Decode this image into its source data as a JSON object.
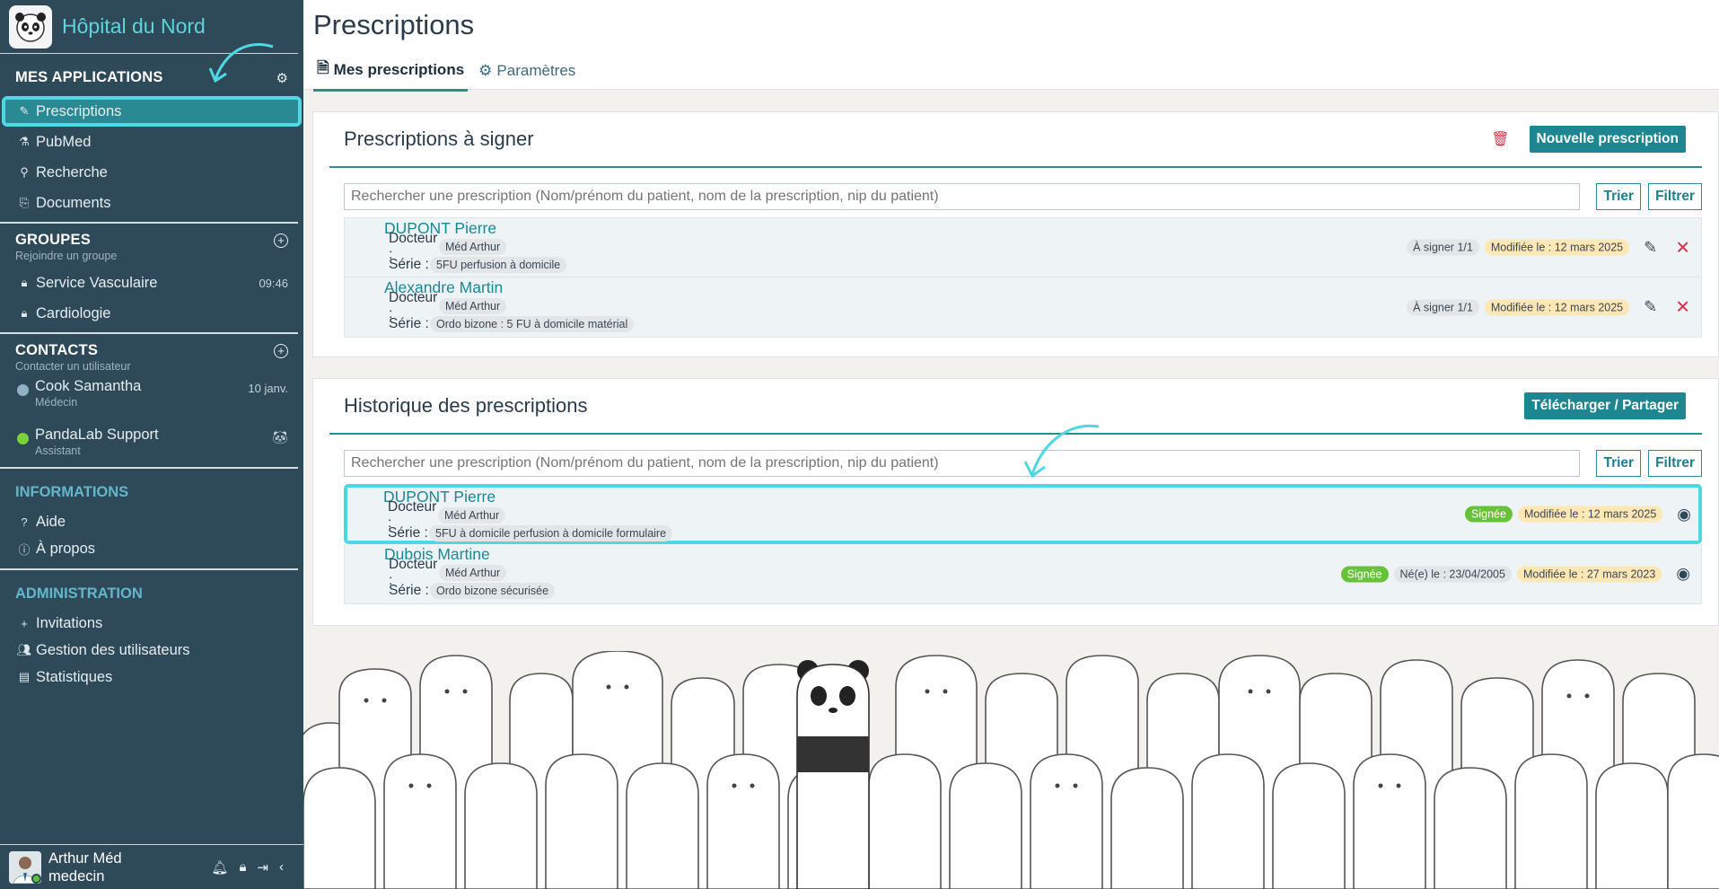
{
  "sidebar": {
    "brand": "Hôpital du Nord",
    "apps": {
      "title": "MES APPLICATIONS",
      "items": [
        {
          "label": "Prescriptions"
        },
        {
          "label": "PubMed"
        },
        {
          "label": "Recherche"
        },
        {
          "label": "Documents"
        }
      ]
    },
    "groups": {
      "title": "GROUPES",
      "subtitle": "Rejoindre un groupe",
      "items": [
        {
          "label": "Service Vasculaire",
          "time": "09:46"
        },
        {
          "label": "Cardiologie",
          "time": ""
        }
      ]
    },
    "contacts": {
      "title": "CONTACTS",
      "subtitle": "Contacter un utilisateur",
      "items": [
        {
          "name": "Cook Samantha",
          "role": "Médecin",
          "meta": "10 janv.",
          "status_color": "#8fb2c4"
        },
        {
          "name": "PandaLab Support",
          "role": "Assistant",
          "meta": "",
          "status_color": "#7bd13a"
        }
      ]
    },
    "informations": {
      "title": "INFORMATIONS",
      "items": [
        {
          "label": "Aide"
        },
        {
          "label": "À propos"
        }
      ]
    },
    "administration": {
      "title": "ADMINISTRATION",
      "items": [
        {
          "label": "Invitations"
        },
        {
          "label": "Gestion des utilisateurs"
        },
        {
          "label": "Statistiques"
        }
      ]
    },
    "user": {
      "name": "Arthur Méd",
      "role": "medecin"
    }
  },
  "header": {
    "title": "Prescriptions",
    "tabs": [
      {
        "label": "Mes prescriptions"
      },
      {
        "label": "Paramètres"
      }
    ]
  },
  "to_sign": {
    "title": "Prescriptions à signer",
    "new_button": "Nouvelle prescription",
    "search_placeholder": "Rechercher une prescription (Nom/prénom du patient, nom de la prescription, nip du patient)",
    "sort_label": "Trier",
    "filter_label": "Filtrer",
    "doctor_label": "Docteur :",
    "series_label": "Série :",
    "rows": [
      {
        "patient": "DUPONT Pierre",
        "doctor": "Méd Arthur",
        "series": "5FU perfusion à domicile",
        "status": "À signer 1/1",
        "modified": "Modifiée le : 12 mars 2025"
      },
      {
        "patient": "Alexandre Martin",
        "doctor": "Méd Arthur",
        "series": "Ordo bizone : 5 FU à domicile matérial",
        "status": "À signer 1/1",
        "modified": "Modifiée le : 12 mars 2025"
      }
    ]
  },
  "history": {
    "title": "Historique des prescriptions",
    "download_button": "Télécharger / Partager",
    "search_placeholder": "Rechercher une prescription (Nom/prénom du patient, nom de la prescription, nip du patient)",
    "sort_label": "Trier",
    "filter_label": "Filtrer",
    "doctor_label": "Docteur :",
    "series_label": "Série :",
    "rows": [
      {
        "patient": "DUPONT Pierre",
        "doctor": "Méd Arthur",
        "series": "5FU à domicile perfusion à domicile formulaire",
        "signed": "Signée",
        "born": "",
        "modified": "Modifiée le : 12 mars 2025"
      },
      {
        "patient": "Dubois Martine",
        "doctor": "Méd Arthur",
        "series": "Ordo bizone sécurisée",
        "signed": "Signée",
        "born": "Né(e) le : 23/04/2005",
        "modified": "Modifiée le : 27 mars 2023"
      }
    ]
  },
  "colors": {
    "sidebar_bg": "#2e4a59",
    "accent": "#1d8691",
    "highlight": "#4fd8e3",
    "signed": "#67c23a",
    "modified": "#fde7b4",
    "danger": "#d2344a"
  }
}
